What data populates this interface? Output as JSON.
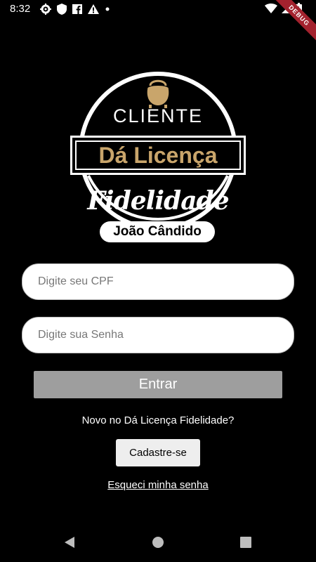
{
  "status_bar": {
    "time": "8:32",
    "left_icons": [
      "gear-icon",
      "shield-icon",
      "facebook-icon",
      "warning-icon",
      "dot-icon"
    ],
    "right_icons": [
      "wifi-icon",
      "signal-icon",
      "battery-icon"
    ]
  },
  "debug_banner": "DEBUG",
  "logo": {
    "top_text": "CLIENTE",
    "banner_text": "Dá Licença",
    "script_text": "Fidelidade",
    "pill_text": "João Cândido",
    "accent_color": "#c9a56b"
  },
  "form": {
    "cpf_placeholder": "Digite seu CPF",
    "cpf_value": "",
    "senha_placeholder": "Digite sua Senha",
    "senha_value": "",
    "submit_label": "Entrar"
  },
  "signup": {
    "prompt": "Novo no Dá Licença Fidelidade?",
    "button_label": "Cadastre-se"
  },
  "forgot_password": "Esqueci minha senha",
  "nav_bar": {
    "buttons": [
      "back-icon",
      "home-icon",
      "recents-icon"
    ]
  }
}
